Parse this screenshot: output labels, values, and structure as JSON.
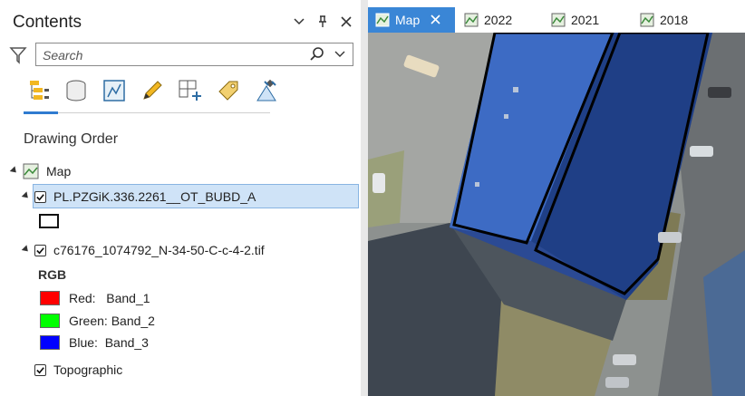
{
  "pane": {
    "title": "Contents",
    "search_placeholder": "Search"
  },
  "toolbar": {
    "items": [
      "list-by-drawing-order",
      "list-by-data-source",
      "list-by-selection",
      "list-by-editing",
      "list-by-snapping",
      "list-by-labeling",
      "list-by-perspective-imagery"
    ]
  },
  "section": {
    "title": "Drawing Order"
  },
  "tree": {
    "map_label": "Map",
    "layer1": {
      "label": "PL.PZGiK.336.2261__OT_BUBD_A",
      "checked": true,
      "selected": true
    },
    "layer2": {
      "label": "c76176_1074792_N-34-50-C-c-4-2.tif",
      "checked": true
    },
    "rgb_label": "RGB",
    "bands": [
      {
        "label": "Red:   Band_1",
        "color": "#ff0000"
      },
      {
        "label": "Green: Band_2",
        "color": "#00ff00"
      },
      {
        "label": "Blue:  Band_3",
        "color": "#0000ff"
      }
    ],
    "layer3": {
      "label": "Topographic",
      "checked": true
    }
  },
  "tabs": [
    {
      "label": "Map",
      "active": true
    },
    {
      "label": "2022",
      "active": false
    },
    {
      "label": "2021",
      "active": false
    },
    {
      "label": "2018",
      "active": false
    }
  ],
  "colors": {
    "accent": "#3a86d6",
    "selection": "#cfe3f7",
    "roof": "#1f3f86"
  }
}
